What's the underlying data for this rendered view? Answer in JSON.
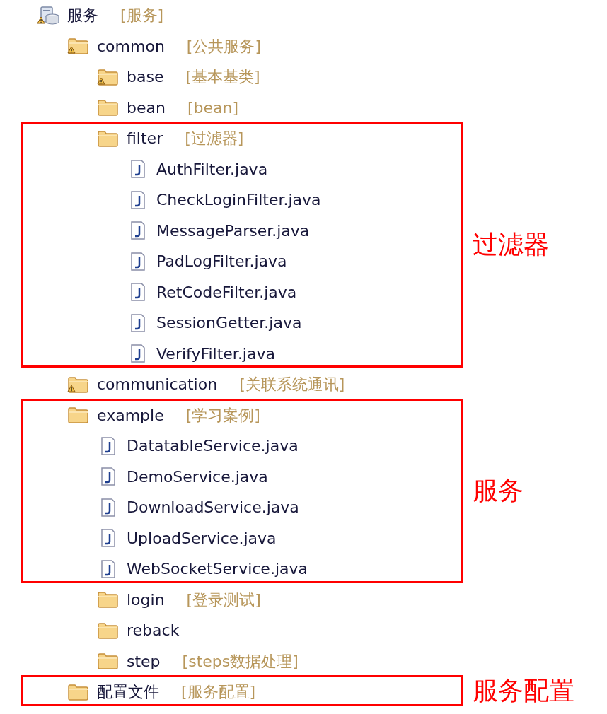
{
  "tree": [
    {
      "kind": "project",
      "name": "服务",
      "note": "[服务]",
      "warning": true,
      "children": [
        {
          "kind": "folder",
          "name": "common",
          "note": "[公共服务]",
          "warning": true,
          "children": [
            {
              "kind": "folder",
              "name": "base",
              "note": "[基本基类]",
              "warning": true
            },
            {
              "kind": "folder",
              "name": "bean",
              "note": "[bean]",
              "warning": false
            },
            {
              "kind": "folder",
              "name": "filter",
              "note": "[过滤器]",
              "warning": false,
              "annotation": "过滤器",
              "children": [
                {
                  "kind": "file",
                  "name": "AuthFilter.java"
                },
                {
                  "kind": "file",
                  "name": "CheckLoginFilter.java"
                },
                {
                  "kind": "file",
                  "name": "MessageParser.java"
                },
                {
                  "kind": "file",
                  "name": "PadLogFilter.java"
                },
                {
                  "kind": "file",
                  "name": "RetCodeFilter.java"
                },
                {
                  "kind": "file",
                  "name": "SessionGetter.java"
                },
                {
                  "kind": "file",
                  "name": "VerifyFilter.java"
                }
              ]
            }
          ]
        },
        {
          "kind": "folder",
          "name": "communication",
          "note": "[关联系统通讯]",
          "warning": true
        },
        {
          "kind": "folder",
          "name": "example",
          "note": "[学习案例]",
          "warning": false,
          "annotation": "服务",
          "children": [
            {
              "kind": "file",
              "name": "DatatableService.java"
            },
            {
              "kind": "file",
              "name": "DemoService.java"
            },
            {
              "kind": "file",
              "name": "DownloadService.java"
            },
            {
              "kind": "file",
              "name": "UploadService.java"
            },
            {
              "kind": "file",
              "name": "WebSocketService.java"
            },
            {
              "kind": "folder",
              "name": "login",
              "note": "[登录测试]",
              "warning": false
            },
            {
              "kind": "folder",
              "name": "reback",
              "warning": false
            },
            {
              "kind": "folder",
              "name": "step",
              "note": "[steps数据处理]",
              "warning": false
            }
          ]
        },
        {
          "kind": "folder",
          "name": "配置文件",
          "note": "[服务配置]",
          "warning": false,
          "annotation": "服务配置"
        }
      ]
    }
  ]
}
